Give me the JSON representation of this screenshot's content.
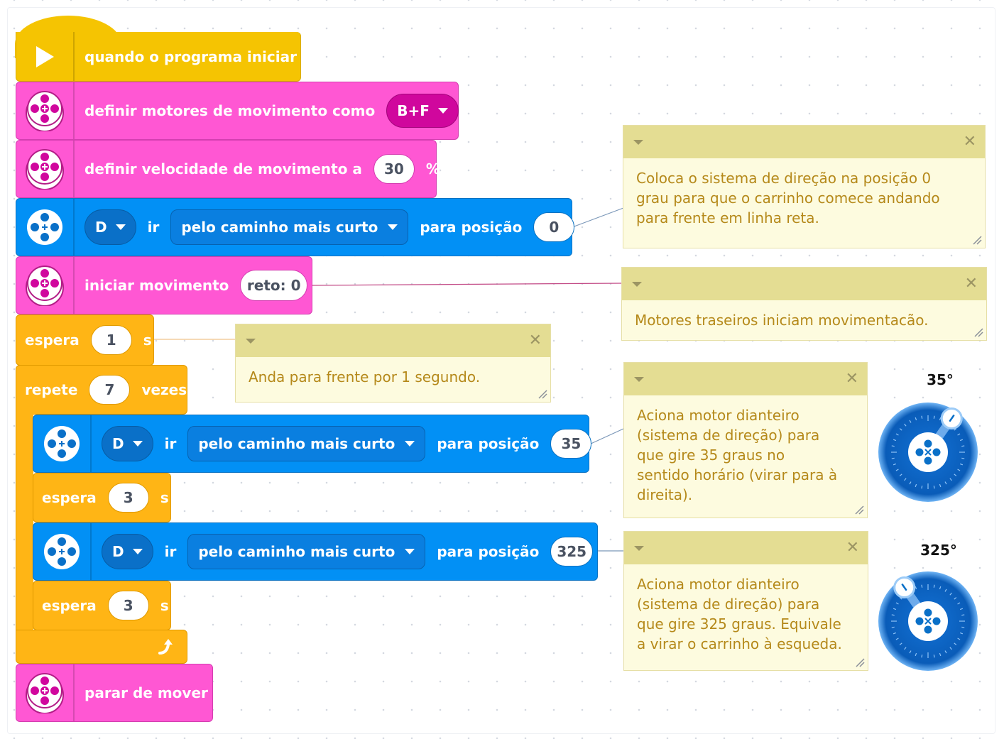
{
  "blocks": {
    "start": {
      "label": "quando o programa iniciar"
    },
    "set_motors": {
      "label": "definir motores de movimento como",
      "value": "B+F"
    },
    "set_speed": {
      "label": "definir velocidade de movimento a",
      "value": "30",
      "unit": "%"
    },
    "motor_go_1": {
      "port": "D",
      "verb": "ir",
      "mode": "pelo caminho mais curto",
      "target_label": "para posição",
      "position": "0"
    },
    "start_move": {
      "label": "iniciar movimento",
      "value": "reto: 0"
    },
    "wait_1": {
      "label": "espera",
      "value": "1",
      "unit": "s"
    },
    "repeat": {
      "label": "repete",
      "value": "7",
      "unit": "vezes"
    },
    "motor_go_2": {
      "port": "D",
      "verb": "ir",
      "mode": "pelo caminho mais curto",
      "target_label": "para posição",
      "position": "35"
    },
    "wait_2": {
      "label": "espera",
      "value": "3",
      "unit": "s"
    },
    "motor_go_3": {
      "port": "D",
      "verb": "ir",
      "mode": "pelo caminho mais curto",
      "target_label": "para posição",
      "position": "325"
    },
    "wait_3": {
      "label": "espera",
      "value": "3",
      "unit": "s"
    },
    "stop": {
      "label": "parar de mover"
    }
  },
  "comments": {
    "c1": "Coloca o sistema de direção na posição 0\ngrau para que o carrinho comece andando\npara frente em linha reta.",
    "c2": "Motores traseiros iniciam movimentacão.",
    "c3": "Anda para frente por 1 segundo.",
    "c4": "Aciona motor dianteiro\n(sistema de direção) para\nque gire 35 graus no\nsentido horário (virar para à\ndireita).",
    "c5": "Aciona motor dianteiro\n(sistema de direção) para\nque gire 325 graus. Equivale\na virar o carrinho à esqueda."
  },
  "dials": {
    "d1": {
      "label": "35°",
      "angle_degrees": 35
    },
    "d2": {
      "label": "325°",
      "angle_degrees": 325
    }
  },
  "colors": {
    "event": "#f5c402",
    "movement": "#ff57d3",
    "motor": "#0290f5",
    "control": "#ffb515",
    "comment": "#fdfbdf"
  },
  "icons": {
    "start": "play-triangle-icon",
    "movement": "movement-wheel-icon",
    "motor": "motor-icon",
    "loop_end": "loop-arrow-icon",
    "comment_collapse": "comment-collapse-caret-icon",
    "comment_close": "comment-close-icon",
    "comment_resize": "comment-resize-icon"
  }
}
